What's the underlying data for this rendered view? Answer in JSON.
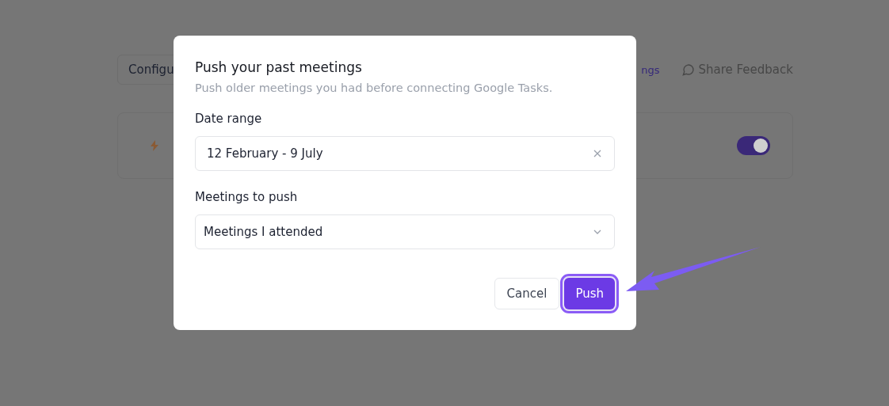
{
  "background": {
    "config_button": "Configu",
    "settings_link": "ngs",
    "feedback_link": "Share Feedback",
    "card": {
      "toggle": {
        "on": true
      }
    }
  },
  "dialog": {
    "title": "Push your past meetings",
    "subtitle": "Push older meetings you had before connecting Google Tasks.",
    "date_range": {
      "label": "Date range",
      "value": "12 February - 9 July"
    },
    "meetings": {
      "label": "Meetings to push",
      "value": "Meetings I attended"
    },
    "buttons": [
      {
        "label": "Cancel",
        "kind": "secondary",
        "highlighted": false
      },
      {
        "label": "Push",
        "kind": "primary",
        "highlighted": true
      }
    ]
  }
}
